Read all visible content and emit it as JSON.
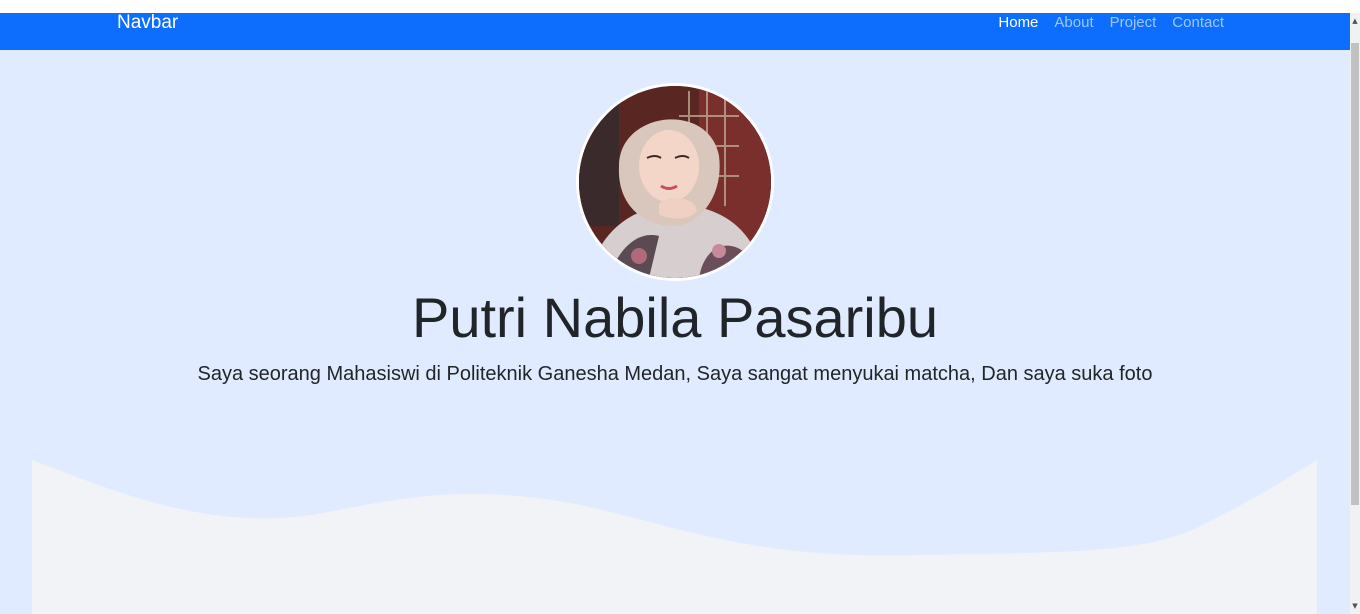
{
  "navbar": {
    "brand": "Navbar",
    "links": [
      {
        "label": "Home",
        "active": true
      },
      {
        "label": "About",
        "active": false
      },
      {
        "label": "Project",
        "active": false
      },
      {
        "label": "Contact",
        "active": false
      }
    ]
  },
  "hero": {
    "name": "Putri Nabila Pasaribu",
    "tagline": "Saya seorang Mahasiswi di Politeknik Ganesha Medan, Saya sangat menyukai matcha, Dan saya suka foto"
  },
  "colors": {
    "navbar_bg": "#0d6efd",
    "hero_bg": "#e0ebff",
    "wave_fill": "#f1f3f6"
  },
  "icons": {
    "scroll_up": "caret-up-icon",
    "scroll_down": "caret-down-icon"
  }
}
